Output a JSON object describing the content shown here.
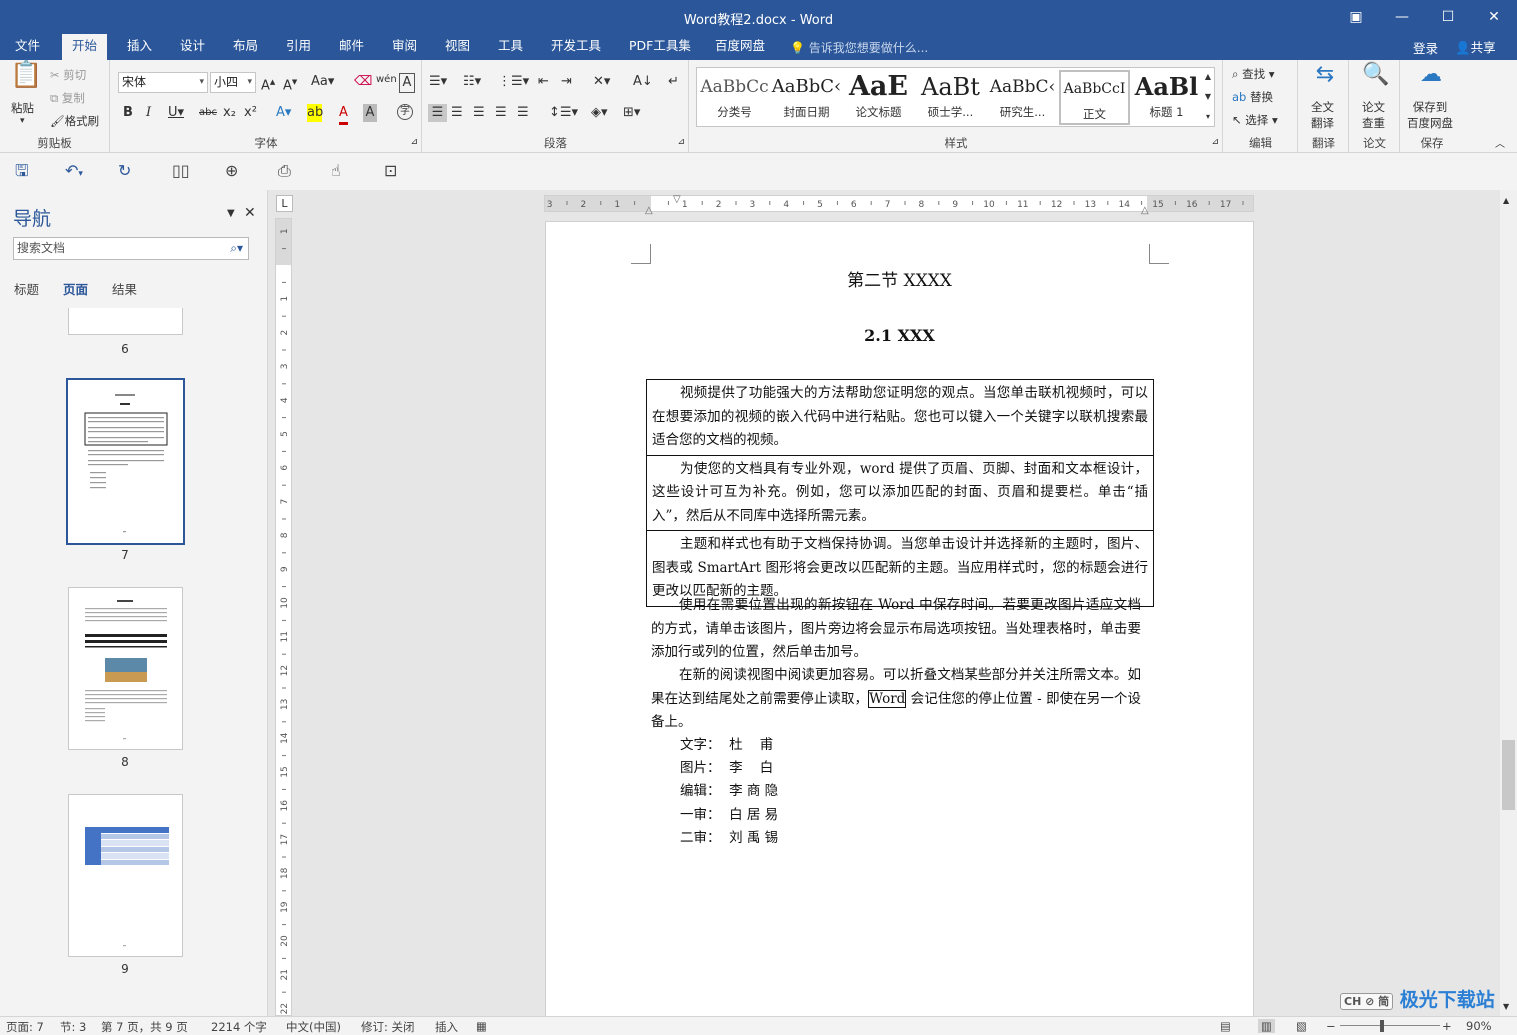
{
  "app": {
    "title": "Word教程2.docx - Word",
    "window_controls": {
      "restore_icon": "ribbon-display-icon",
      "minimize": "—",
      "maximize": "☐",
      "close": "✕"
    }
  },
  "tabs": [
    "文件",
    "开始",
    "插入",
    "设计",
    "布局",
    "引用",
    "邮件",
    "审阅",
    "视图",
    "工具",
    "开发工具",
    "PDF工具集",
    "百度网盘"
  ],
  "active_tab": "开始",
  "tell_me": "告诉我您想要做什么...",
  "login": "登录",
  "share": "共享",
  "ribbon": {
    "clipboard": {
      "label": "剪贴板",
      "paste": "粘贴",
      "cut": "剪切",
      "copy": "复制",
      "format_painter": "格式刷"
    },
    "font": {
      "label": "字体",
      "font_name": "宋体",
      "font_size": "小四"
    },
    "paragraph": {
      "label": "段落"
    },
    "styles": {
      "label": "样式",
      "items": [
        {
          "sample": "AaBbCc",
          "name": "分类号"
        },
        {
          "sample": "AaBbC‹",
          "name": "封面日期"
        },
        {
          "sample": "AaE",
          "name": "论文标题"
        },
        {
          "sample": "AaBt",
          "name": "硕士学..."
        },
        {
          "sample": "AaBbC‹",
          "name": "研究生..."
        },
        {
          "sample": "AaBbCcI",
          "name": "正文"
        },
        {
          "sample": "AaBl",
          "name": "标题 1"
        }
      ],
      "selected_index": 5
    },
    "editing": {
      "label": "编辑",
      "find": "查找",
      "replace": "替换",
      "select": "选择"
    },
    "translate": {
      "label": "翻译",
      "button_line1": "全文",
      "button_line2": "翻译"
    },
    "paper": {
      "label": "论文",
      "button_line1": "论文",
      "button_line2": "查重"
    },
    "save": {
      "label": "保存",
      "button_line1": "保存到",
      "button_line2": "百度网盘"
    }
  },
  "nav": {
    "title": "导航",
    "search_placeholder": "搜索文档",
    "tabs": [
      "标题",
      "页面",
      "结果"
    ],
    "active_tab": "页面",
    "pages": [
      "6",
      "7",
      "8",
      "9"
    ],
    "selected_page": "7"
  },
  "document": {
    "section_title": "第二节 XXXX",
    "heading": "2.1 XXX",
    "table_cells": [
      "视频提供了功能强大的方法帮助您证明您的观点。当您单击联机视频时，可以在想要添加的视频的嵌入代码中进行粘贴。您也可以键入一个关键字以联机搜索最适合您的文档的视频。",
      "为使您的文档具有专业外观，word 提供了页眉、页脚、封面和文本框设计，这些设计可互为补充。例如，您可以添加匹配的封面、页眉和提要栏。单击“插入”，然后从不同库中选择所需元素。",
      "主题和样式也有助于文档保持协调。当您单击设计并选择新的主题时，图片、图表或 SmartArt 图形将会更改以匹配新的主题。当应用样式时，您的标题会进行更改以匹配新的主题。"
    ],
    "para1": "使用在需要位置出现的新按钮在 Word 中保存时间。若要更改图片适应文档的方式，请单击该图片，图片旁边将会显示布局选项按钮。当处理表格时，单击要添加行或列的位置，然后单击加号。",
    "para2_before": "在新的阅读视图中阅读更加容易。可以折叠文档某些部分并关注所需文本。如果在达到结尾处之前需要停止读取，",
    "para2_boxed": "Word",
    "para2_after": " 会记住您的停止位置 - 即使在另一个设备上。",
    "credits": [
      "文字：  杜    甫",
      "图片：  李    白",
      "编辑：  李 商 隐",
      "一审：  白 居 易",
      "二审：  刘 禹 锡"
    ]
  },
  "status": {
    "page": "页面: 7",
    "section": "节: 3",
    "page_of": "第 7 页，共 9 页",
    "words": "2214 个字",
    "language": "中文(中国)",
    "track_changes": "修订: 关闭",
    "insert_mode": "插入",
    "zoom": "90%"
  },
  "watermark": "极光下载站"
}
